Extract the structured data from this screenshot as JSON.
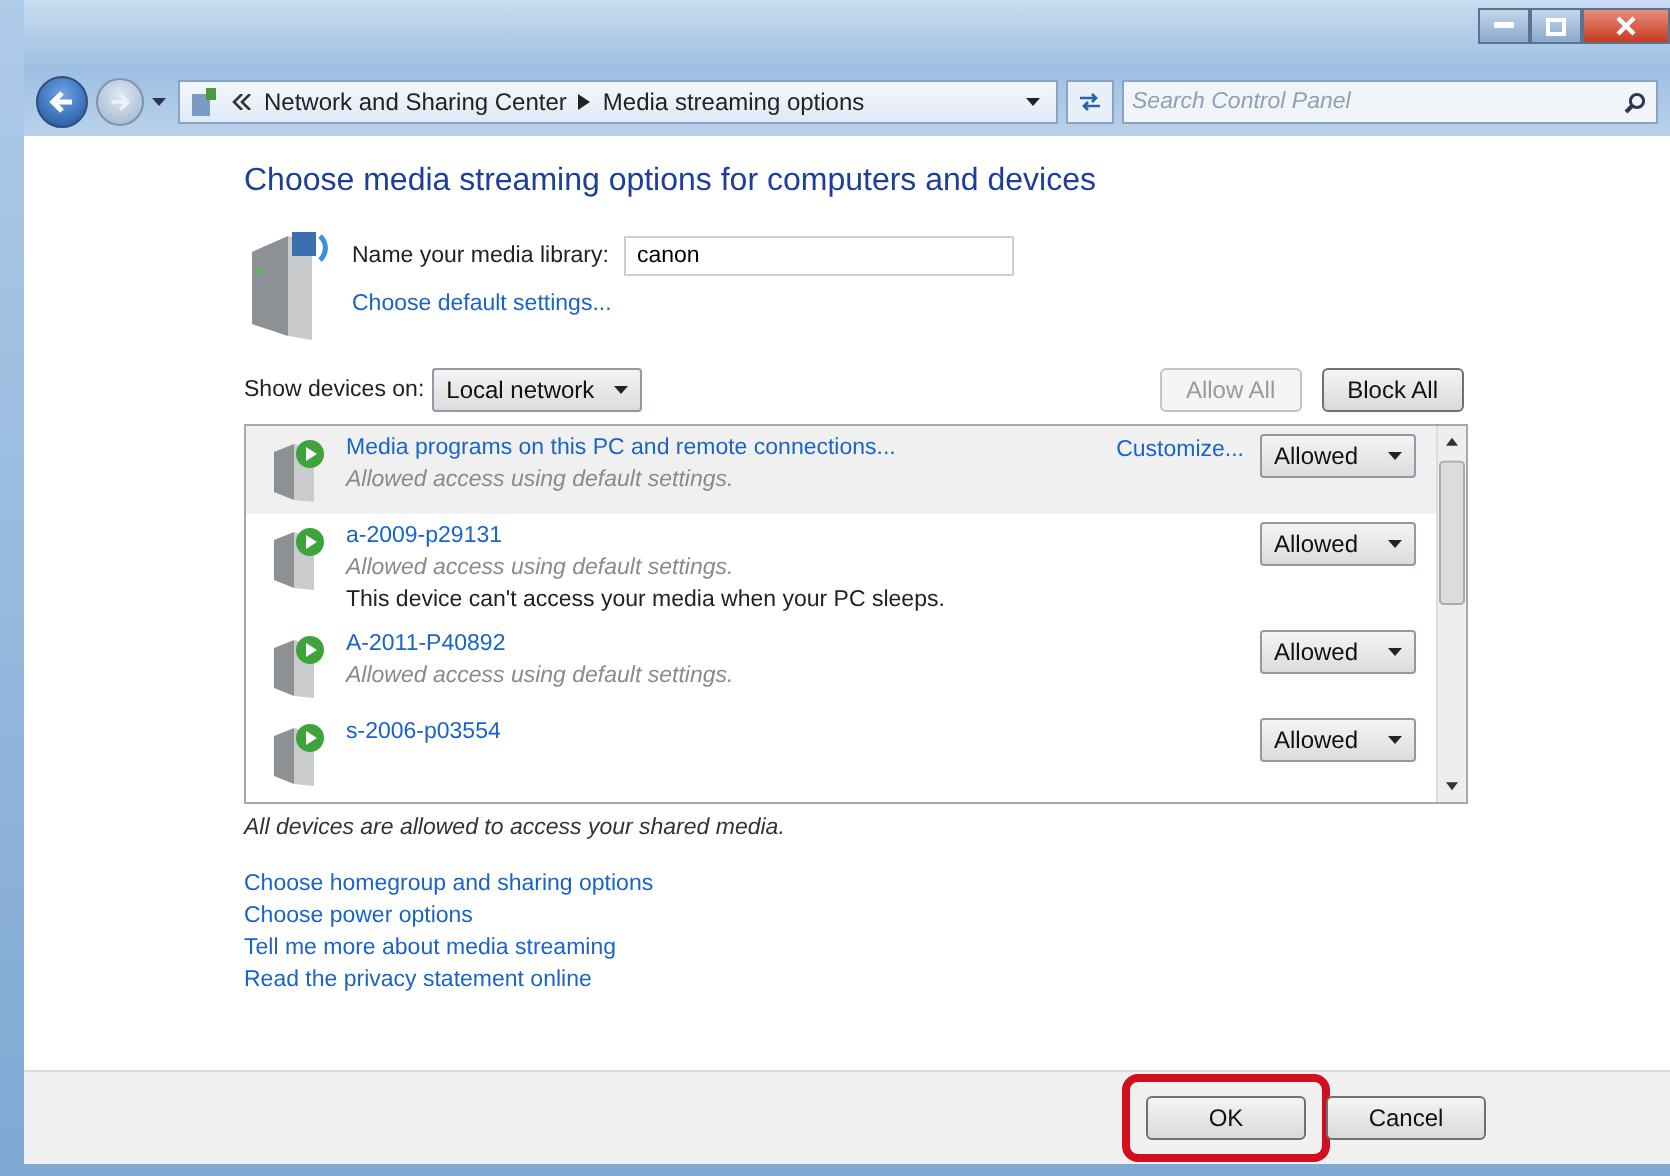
{
  "address_bar": {
    "breadcrumbs": [
      "Network and Sharing Center",
      "Media streaming options"
    ]
  },
  "search": {
    "placeholder": "Search Control Panel"
  },
  "heading": "Choose media streaming options for computers and devices",
  "library": {
    "label": "Name your media library:",
    "value": "canon",
    "link": "Choose default settings..."
  },
  "show_devices": {
    "label": "Show devices on:",
    "value": "Local network"
  },
  "list_buttons": [
    {
      "label": "Allow All",
      "disabled": true
    },
    {
      "label": "Block All",
      "disabled": false
    }
  ],
  "devices": [
    {
      "name": "Media programs on this PC and remote connections...",
      "status": "Allowed access using default settings.",
      "customize": "Customize...",
      "permission": "Allowed",
      "selected": true
    },
    {
      "name": "a-2009-p29131",
      "status": "Allowed access using default settings.",
      "note": "This device can't access your media when your PC sleeps.",
      "permission": "Allowed",
      "selected": false
    },
    {
      "name": "A-2011-P40892",
      "status": "Allowed access using default settings.",
      "permission": "Allowed",
      "selected": false
    },
    {
      "name": "s-2006-p03554",
      "permission": "Allowed",
      "selected": false
    }
  ],
  "summary": "All devices are allowed to access your shared media.",
  "links": [
    "Choose homegroup and sharing options",
    "Choose power options",
    "Tell me more about media streaming",
    "Read the privacy statement online"
  ],
  "footer_buttons": [
    {
      "label": "OK",
      "highlighted": true
    },
    {
      "label": "Cancel",
      "highlighted": false
    }
  ]
}
